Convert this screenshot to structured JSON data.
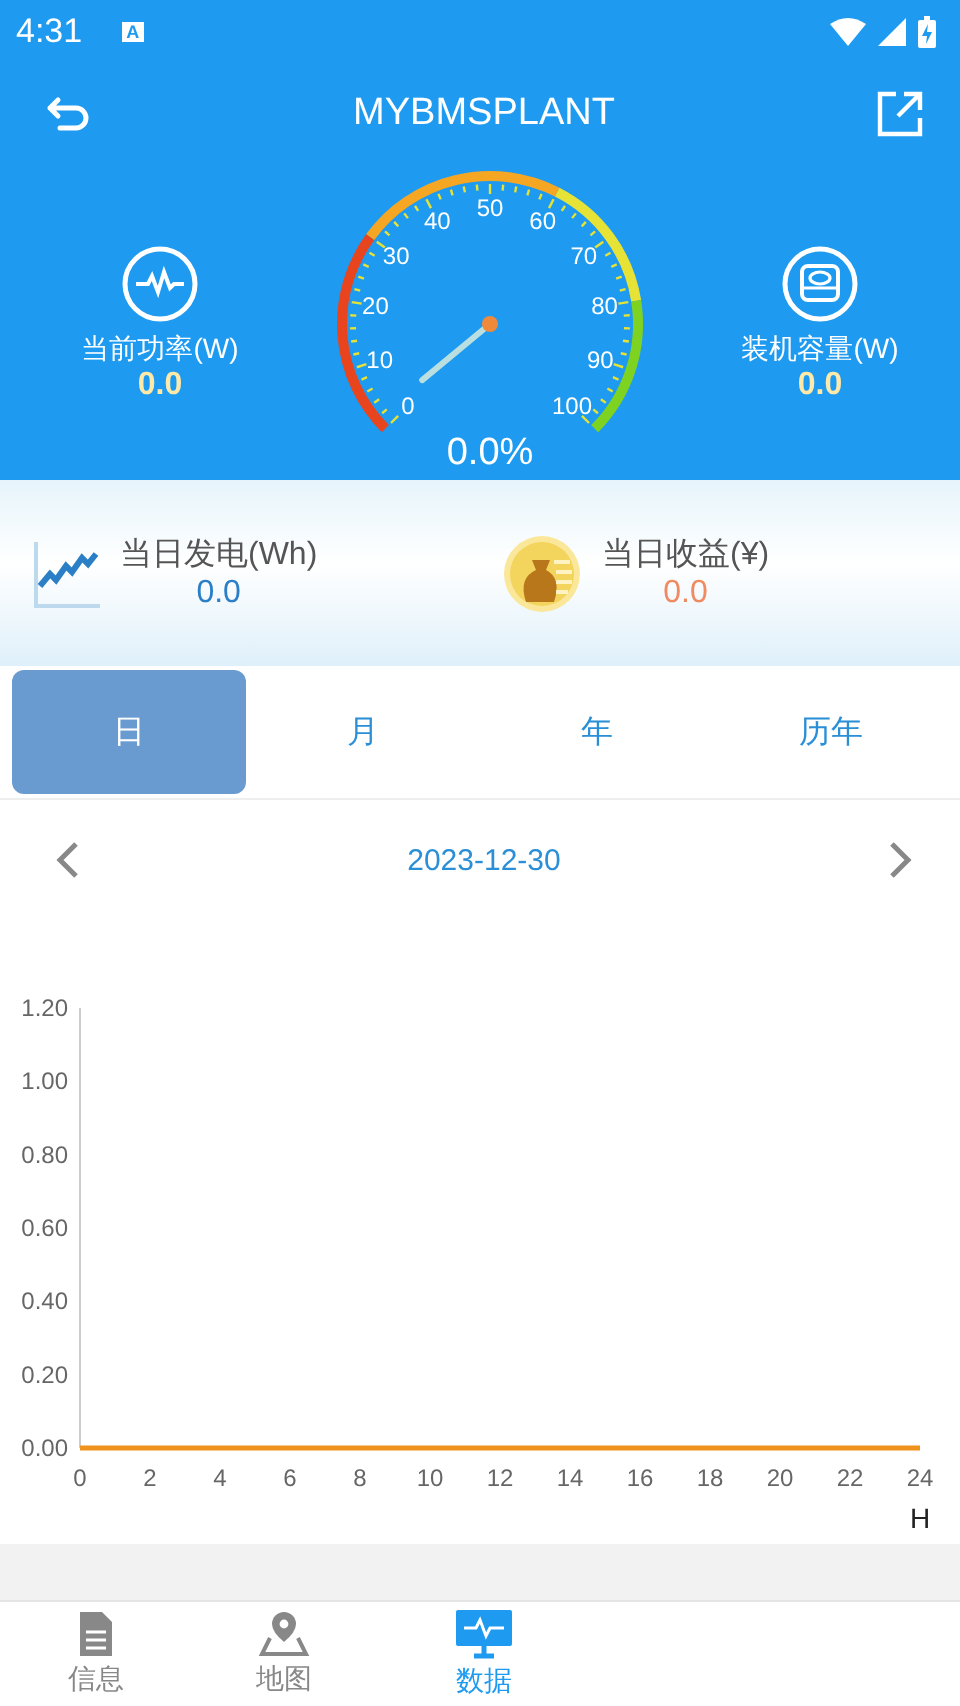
{
  "status_bar": {
    "time": "4:31",
    "notification": "A"
  },
  "header": {
    "title": "MYBMSPLANT"
  },
  "power": {
    "label": "当前功率(W)",
    "value": "0.0"
  },
  "capacity": {
    "label": "装机容量(W)",
    "value": "0.0"
  },
  "gauge": {
    "reading": "0.0%",
    "scale_labels": [
      "0",
      "10",
      "20",
      "30",
      "40",
      "50",
      "60",
      "70",
      "80",
      "90",
      "100"
    ]
  },
  "summary": [
    {
      "kind": "energy",
      "label": "当日发电(Wh)",
      "value": "0.0"
    },
    {
      "kind": "income",
      "label": "当日收益(¥)",
      "value": "0.0"
    }
  ],
  "tabs": [
    {
      "label": "日",
      "selected": true
    },
    {
      "label": "月",
      "selected": false
    },
    {
      "label": "年",
      "selected": false
    },
    {
      "label": "历年",
      "selected": false
    }
  ],
  "date": "2023-12-30",
  "chart": {
    "chart_data": {
      "type": "line",
      "xlabel": "H",
      "x": [
        0,
        24
      ],
      "series": [
        {
          "color": "#f0921e",
          "values": [
            0,
            0
          ]
        }
      ],
      "xlim": [
        0,
        24
      ],
      "ylim": [
        0,
        1.2
      ],
      "xticks": [
        0,
        2,
        4,
        6,
        8,
        10,
        12,
        14,
        16,
        18,
        20,
        22,
        24
      ],
      "yticks": [
        {
          "value": 0,
          "label": "0.00"
        },
        {
          "value": 0.2,
          "label": "0.20"
        },
        {
          "value": 0.4,
          "label": "0.40"
        },
        {
          "value": 0.6,
          "label": "0.60"
        },
        {
          "value": 0.8,
          "label": "0.80"
        },
        {
          "value": 1,
          "label": "1.00"
        },
        {
          "value": 1.2,
          "label": "1.20"
        }
      ]
    }
  },
  "bottom_nav": [
    {
      "kind": "info",
      "label": "信息",
      "selected": false
    },
    {
      "kind": "map",
      "label": "地图",
      "selected": false
    },
    {
      "kind": "data",
      "label": "数据",
      "selected": true
    }
  ]
}
